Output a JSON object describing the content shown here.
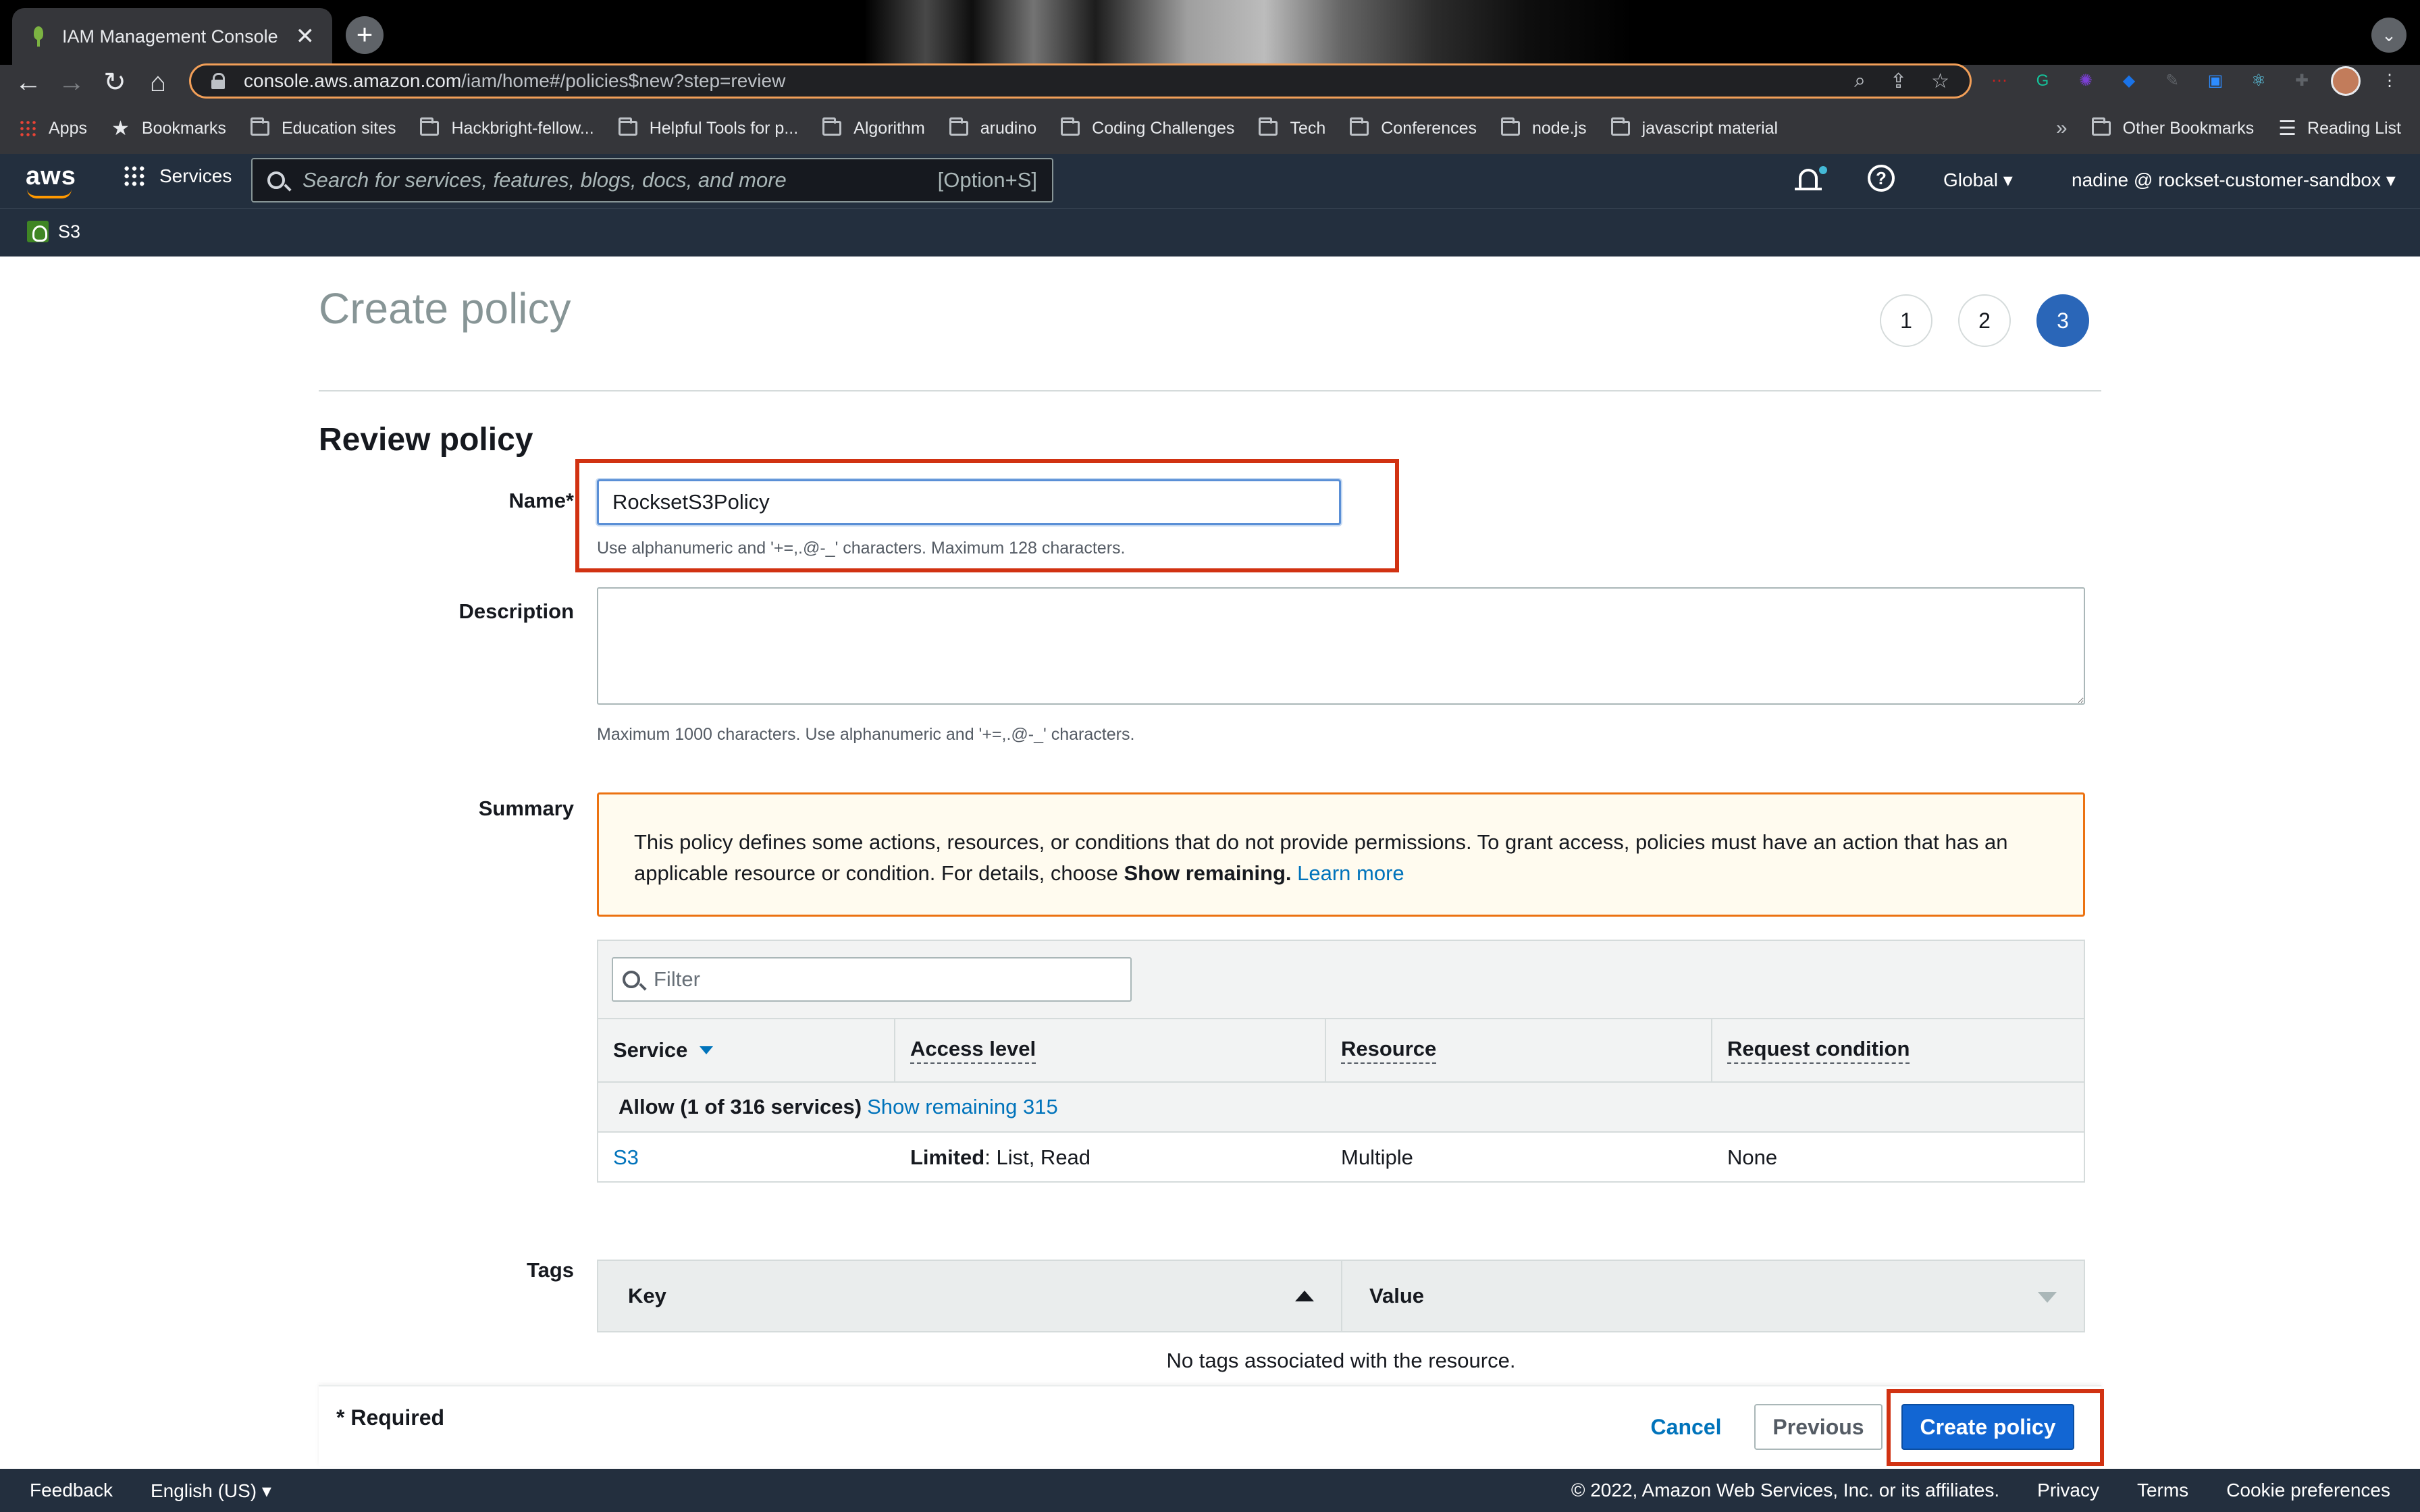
{
  "browser": {
    "tab_title": "IAM Management Console",
    "tab_close": "✕",
    "new_tab": "+",
    "tab_menu": "⌄",
    "url_host": "console.aws.amazon.com",
    "url_path": "/iam/home#/policies$new?step=review",
    "nav": {
      "back": "←",
      "forward": "→",
      "reload": "↻",
      "home": "⌂"
    },
    "omni_icons": [
      "⌕",
      "⇪",
      "☆"
    ],
    "extensions": [
      {
        "glyph": "⋯",
        "color": "#c5221f"
      },
      {
        "glyph": "G",
        "color": "#15c39a"
      },
      {
        "glyph": "✺",
        "color": "#7b3fd6"
      },
      {
        "glyph": "◆",
        "color": "#1a73e8"
      },
      {
        "glyph": "✎",
        "color": "#5f6368"
      },
      {
        "glyph": "▣",
        "color": "#2d8cff"
      },
      {
        "glyph": "⚛",
        "color": "#61dafb"
      },
      {
        "glyph": "✚",
        "color": "#5f6368"
      }
    ],
    "menu_dots": "⋮",
    "bookmarks": [
      {
        "label": "Apps",
        "kind": "apps"
      },
      {
        "label": "Bookmarks",
        "kind": "star"
      },
      {
        "label": "Education sites",
        "kind": "folder"
      },
      {
        "label": "Hackbright-fellow...",
        "kind": "folder"
      },
      {
        "label": "Helpful Tools for p...",
        "kind": "folder"
      },
      {
        "label": "Algorithm",
        "kind": "folder"
      },
      {
        "label": "arudino",
        "kind": "folder"
      },
      {
        "label": "Coding Challenges",
        "kind": "folder"
      },
      {
        "label": "Tech",
        "kind": "folder"
      },
      {
        "label": "Conferences",
        "kind": "folder"
      },
      {
        "label": "node.js",
        "kind": "folder"
      },
      {
        "label": "javascript material",
        "kind": "folder"
      }
    ],
    "bookmarks_overflow": "»",
    "other_bookmarks": "Other Bookmarks",
    "reading_list": "Reading List"
  },
  "aws_nav": {
    "logo": "aws",
    "services": "Services",
    "search_placeholder": "Search for services, features, blogs, docs, and more",
    "search_shortcut": "[Option+S]",
    "help": "?",
    "region": "Global ▾",
    "account": "nadine @ rockset-customer-sandbox ▾",
    "favorite": "S3"
  },
  "page": {
    "title": "Create policy",
    "steps": [
      "1",
      "2",
      "3"
    ],
    "active_step": 3,
    "section_title": "Review policy"
  },
  "form": {
    "name_label": "Name*",
    "name_value": "RocksetS3Policy",
    "name_hint": "Use alphanumeric and '+=,.@-_' characters. Maximum 128 characters.",
    "description_label": "Description",
    "description_value": "",
    "description_hint": "Maximum 1000 characters. Use alphanumeric and '+=,.@-_' characters.",
    "summary_label": "Summary"
  },
  "warning": {
    "text": "This policy defines some actions, resources, or conditions that do not provide permissions. To grant access, policies must have an action that has an applicable resource or condition. For details, choose ",
    "bold": "Show remaining.",
    "link": "Learn more"
  },
  "summary": {
    "filter_placeholder": "Filter",
    "columns": [
      "Service",
      "Access level",
      "Resource",
      "Request condition"
    ],
    "allow_label": "Allow (1 of 316 services)",
    "show_remaining": "Show remaining 315",
    "rows": [
      {
        "service": "S3",
        "access_bold": "Limited",
        "access_rest": ": List, Read",
        "resource": "Multiple",
        "condition": "None"
      }
    ]
  },
  "tags": {
    "label": "Tags",
    "key_header": "Key",
    "value_header": "Value",
    "empty": "No tags associated with the resource."
  },
  "actions": {
    "required": "* Required",
    "cancel": "Cancel",
    "previous": "Previous",
    "create": "Create policy"
  },
  "console_footer": {
    "feedback": "Feedback",
    "language": "English (US) ▾",
    "copyright": "© 2022, Amazon Web Services, Inc. or its affiliates.",
    "privacy": "Privacy",
    "terms": "Terms",
    "cookies": "Cookie preferences"
  },
  "colors": {
    "aws_nav_bg": "#232f3e",
    "aws_orange": "#ff9900",
    "primary_button": "#1266d3",
    "active_step": "#2a66b8",
    "link": "#0073bb",
    "warning_border": "#ec7211",
    "highlight_box": "#d13212"
  }
}
